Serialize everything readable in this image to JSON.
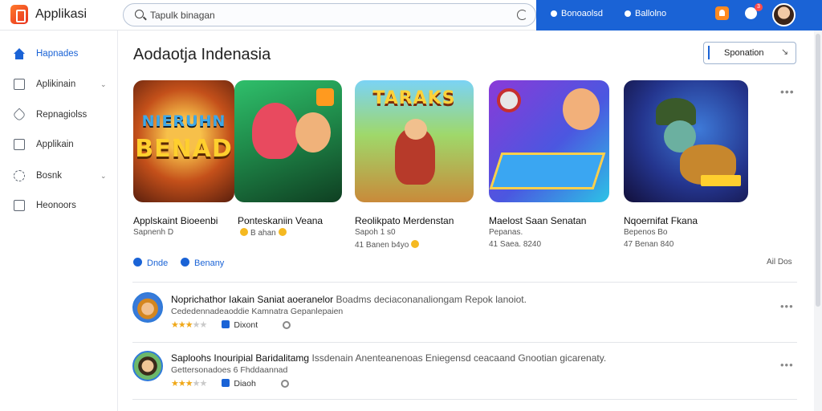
{
  "header": {
    "app_title": "Applikasi",
    "search": {
      "value": "Tapulk binagan",
      "placeholder": ""
    },
    "links": [
      "Bonoaolsd",
      "Ballolno"
    ],
    "notification_badge": "3"
  },
  "sidebar": {
    "items": [
      {
        "label": "Hapnades",
        "icon": "home-icon",
        "active": true,
        "chevron": false
      },
      {
        "label": "Aplikinain",
        "icon": "window-icon",
        "active": false,
        "chevron": true
      },
      {
        "label": "Repnagiolss",
        "icon": "tag-icon",
        "active": false,
        "chevron": false
      },
      {
        "label": "Applikain",
        "icon": "square-icon",
        "active": false,
        "chevron": false
      },
      {
        "label": "Bosnk",
        "icon": "gear-icon",
        "active": false,
        "chevron": true
      },
      {
        "label": "Heonoors",
        "icon": "chart-icon",
        "active": false,
        "chevron": false
      }
    ]
  },
  "main": {
    "title": "Aodaotja Indenasia",
    "sort_label": "Sponation",
    "cards": [
      {
        "art_text": [
          "NIERUHN",
          "BENAD"
        ],
        "name": "Applskaint Bioeenbi",
        "meta": "Sapnenh D",
        "meta2": ""
      },
      {
        "art_text": [],
        "name": "Ponteskaniin Veana",
        "meta": "B   ahan",
        "meta2": ""
      },
      {
        "art_text": [
          "TARAKS"
        ],
        "name": "Reolikpato Merdenstan",
        "meta": "Sapoh 1 s0",
        "meta2": "41 Banen   b4yo"
      },
      {
        "art_text": [],
        "name": "Maelost Saan Senatan",
        "meta": "Pepanas.",
        "meta2": "41 Saea.   8240"
      },
      {
        "art_text": [],
        "name": "Nqoernifat Fkana",
        "meta": "Bepenos Bo",
        "meta2": "47 Benan   840"
      }
    ],
    "chips": [
      "Dnde",
      "Benany"
    ],
    "all_link": "Ail Dos",
    "rows": [
      {
        "title": "Noprichathor Iakain Saniat aoeranelor",
        "desc": "Boadms deciaconanaliongam Repok lanoiot.",
        "sub": "Cededennadeaoddie Kamnatra Gepanlepaien",
        "stars": 3,
        "tag": "Dixont"
      },
      {
        "title": "Saploohs Inouripial Baridalitamg",
        "desc": "Issdenain Anenteanenoas Eniegensd ceacaand Gnootian gicarenaty.",
        "sub": "Gettersonadoes 6 Fhddaannad",
        "stars": 3,
        "tag": "Diaoh"
      }
    ]
  },
  "colors": {
    "accent": "#1a63d6",
    "star": "#f0a818",
    "logo": "#e8321f"
  }
}
